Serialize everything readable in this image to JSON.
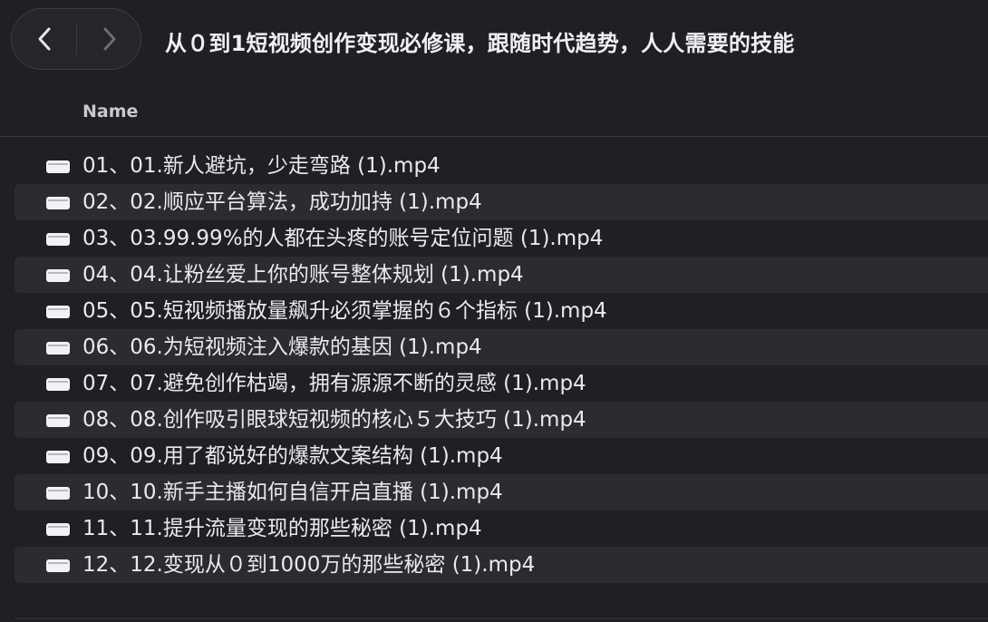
{
  "window": {
    "title": "从０到1短视频创作变现必修课，跟随时代趋势，人人需要的技能"
  },
  "toolbar": {
    "back_icon": "chevron-left-icon",
    "forward_icon": "chevron-right-icon"
  },
  "columns": {
    "name_label": "Name"
  },
  "files": [
    {
      "name": "01、01.新人避坑，少走弯路 (1).mp4",
      "icon": "video-file-icon"
    },
    {
      "name": "02、02.顺应平台算法，成功加持 (1).mp4",
      "icon": "video-file-icon"
    },
    {
      "name": "03、03.99.99%的人都在头疼的账号定位问题 (1).mp4",
      "icon": "video-file-icon"
    },
    {
      "name": "04、04.让粉丝爱上你的账号整体规划 (1).mp4",
      "icon": "video-file-icon"
    },
    {
      "name": "05、05.短视频播放量飙升必须掌握的６个指标 (1).mp4",
      "icon": "video-file-icon"
    },
    {
      "name": "06、06.为短视频注入爆款的基因 (1).mp4",
      "icon": "video-file-icon"
    },
    {
      "name": "07、07.避免创作枯竭，拥有源源不断的灵感 (1).mp4",
      "icon": "video-file-icon"
    },
    {
      "name": "08、08.创作吸引眼球短视频的核心５大技巧 (1).mp4",
      "icon": "video-file-icon"
    },
    {
      "name": "09、09.用了都说好的爆款文案结构 (1).mp4",
      "icon": "video-file-icon"
    },
    {
      "name": "10、10.新手主播如何自信开启直播 (1).mp4",
      "icon": "video-file-icon"
    },
    {
      "name": "11、11.提升流量变现的那些秘密 (1).mp4",
      "icon": "video-file-icon"
    },
    {
      "name": "12、12.变现从０到1000万的那些秘密 (1).mp4",
      "icon": "video-file-icon"
    }
  ],
  "colors": {
    "background": "#1f2024",
    "row_alt": "#2b2c31",
    "text": "#eaeaec"
  }
}
